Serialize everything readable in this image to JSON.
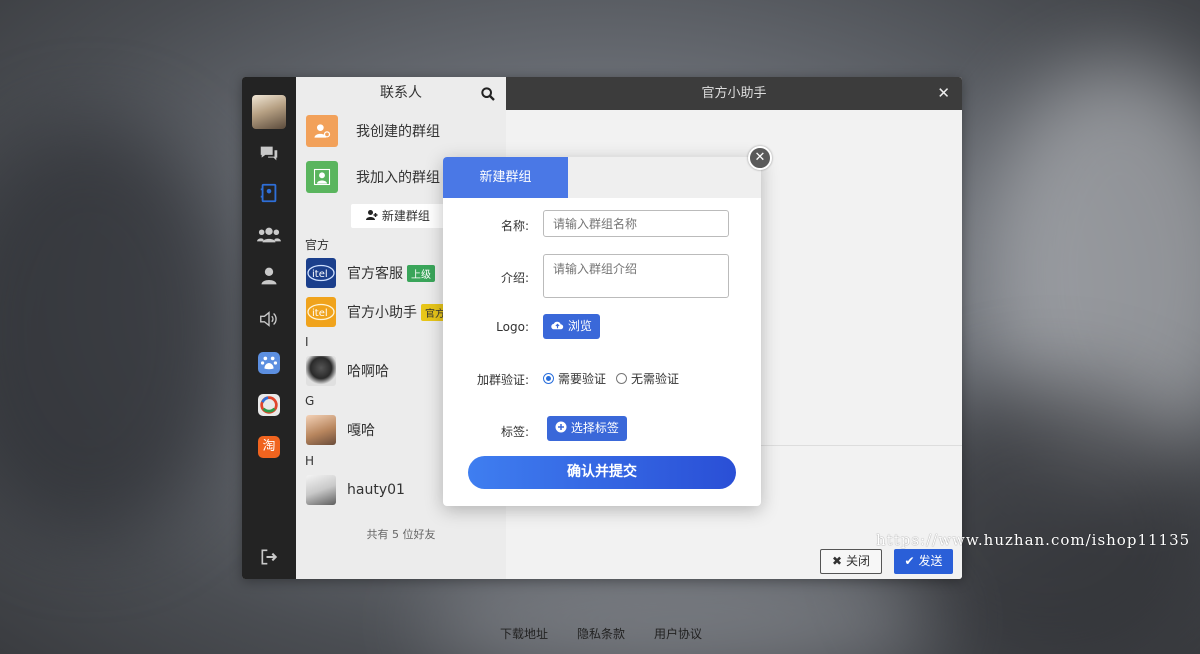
{
  "contacts_panel": {
    "title": "联系人",
    "groups": [
      {
        "label": "我创建的群组",
        "color": "#f2a15a"
      },
      {
        "label": "我加入的群组",
        "color": "#5ab55e"
      }
    ],
    "new_group_label": "新建群组",
    "sections": [
      {
        "header": "官方",
        "friends": [
          {
            "name": "官方客服",
            "badge": "上级",
            "badge_color": "#3aa55a"
          },
          {
            "name": "官方小助手",
            "badge": "官方",
            "badge_color": "#e8c619"
          }
        ]
      },
      {
        "header": "I",
        "friends": [
          {
            "name": "哈啊哈"
          }
        ]
      },
      {
        "header": "G",
        "friends": [
          {
            "name": "嘎哈"
          }
        ]
      },
      {
        "header": "H",
        "friends": [
          {
            "name": "hauty01"
          }
        ]
      }
    ],
    "total_text": "共有 5 位好友"
  },
  "chat": {
    "title": "官方小助手",
    "close_label": "关闭",
    "send_label": "发送"
  },
  "modal": {
    "tab_label": "新建群组",
    "name_label": "名称:",
    "name_placeholder": "请输入群组名称",
    "intro_label": "介绍:",
    "intro_placeholder": "请输入群组介绍",
    "logo_label": "Logo:",
    "browse_label": "浏览",
    "verify_label": "加群验证:",
    "verify_options": [
      {
        "label": "需要验证",
        "selected": true
      },
      {
        "label": "无需验证",
        "selected": false
      }
    ],
    "tag_label": "标签:",
    "choose_tag_label": "选择标签",
    "submit_label": "确认并提交"
  },
  "watermark": "https://www.huzhan.com/ishop11135",
  "footer": {
    "links": [
      "下载地址",
      "隐私条款",
      "用户协议"
    ]
  },
  "colors": {
    "accent": "#3a68d9",
    "rail_bg": "#232323",
    "modal_tab": "#4a78e6"
  }
}
